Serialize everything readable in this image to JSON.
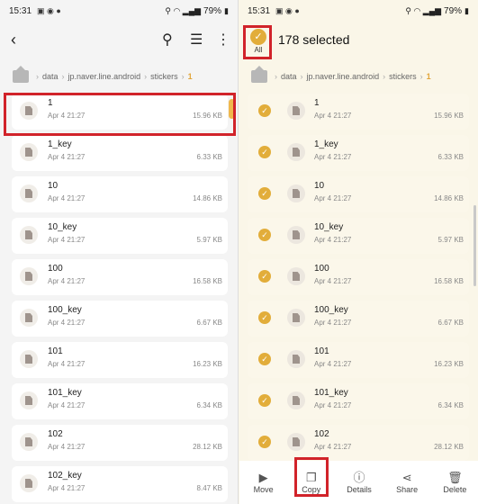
{
  "status": {
    "time": "15:31",
    "battery": "79%"
  },
  "left": {
    "breadcrumb": [
      "data",
      "jp.naver.line.android",
      "stickers",
      "1"
    ],
    "files": [
      {
        "name": "1",
        "date": "Apr 4 21:27",
        "size": "15.96 KB"
      },
      {
        "name": "1_key",
        "date": "Apr 4 21:27",
        "size": "6.33 KB"
      },
      {
        "name": "10",
        "date": "Apr 4 21:27",
        "size": "14.86 KB"
      },
      {
        "name": "10_key",
        "date": "Apr 4 21:27",
        "size": "5.97 KB"
      },
      {
        "name": "100",
        "date": "Apr 4 21:27",
        "size": "16.58 KB"
      },
      {
        "name": "100_key",
        "date": "Apr 4 21:27",
        "size": "6.67 KB"
      },
      {
        "name": "101",
        "date": "Apr 4 21:27",
        "size": "16.23 KB"
      },
      {
        "name": "101_key",
        "date": "Apr 4 21:27",
        "size": "6.34 KB"
      },
      {
        "name": "102",
        "date": "Apr 4 21:27",
        "size": "28.12 KB"
      },
      {
        "name": "102_key",
        "date": "Apr 4 21:27",
        "size": "8.47 KB"
      }
    ]
  },
  "right": {
    "selected_label": "178 selected",
    "all_label": "All",
    "breadcrumb": [
      "data",
      "jp.naver.line.android",
      "stickers",
      "1"
    ],
    "files": [
      {
        "name": "1",
        "date": "Apr 4 21:27",
        "size": "15.96 KB"
      },
      {
        "name": "1_key",
        "date": "Apr 4 21:27",
        "size": "6.33 KB"
      },
      {
        "name": "10",
        "date": "Apr 4 21:27",
        "size": "14.86 KB"
      },
      {
        "name": "10_key",
        "date": "Apr 4 21:27",
        "size": "5.97 KB"
      },
      {
        "name": "100",
        "date": "Apr 4 21:27",
        "size": "16.58 KB"
      },
      {
        "name": "100_key",
        "date": "Apr 4 21:27",
        "size": "6.67 KB"
      },
      {
        "name": "101",
        "date": "Apr 4 21:27",
        "size": "16.23 KB"
      },
      {
        "name": "101_key",
        "date": "Apr 4 21:27",
        "size": "6.34 KB"
      },
      {
        "name": "102",
        "date": "Apr 4 21:27",
        "size": "28.12 KB"
      }
    ],
    "actions": {
      "move": "Move",
      "copy": "Copy",
      "details": "Details",
      "share": "Share",
      "delete": "Delete"
    }
  }
}
